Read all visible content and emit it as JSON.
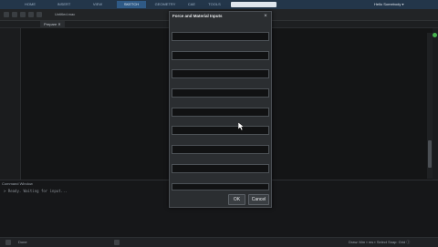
{
  "ribbon": {
    "tabs": [
      "HOME",
      "INSERT",
      "VIEW",
      "SKETCH",
      "GEOMETRY",
      "CAE",
      "TOOLS"
    ],
    "active_index": 3,
    "right_text": "Hello Somebody ▾",
    "accent": "#2f5a86"
  },
  "toolbar": {
    "doc_name": "Untitled.mac"
  },
  "tabstrip": {
    "tab_label": "Prepare ✕"
  },
  "command_window": {
    "title": "Command Window",
    "line": "> Ready. Waiting for input..."
  },
  "statusbar": {
    "left_text": "Done",
    "right_text": "Draw: Mm  ▪  ms  ▪  Select   Snap: Grid   ⓘ"
  },
  "dialog": {
    "title": "Force and Material Inputs",
    "close_glyph": "×",
    "field_count": 9,
    "ok_label": "OK",
    "cancel_label": "Cancel"
  },
  "status_indicator_color": "#46b34d"
}
